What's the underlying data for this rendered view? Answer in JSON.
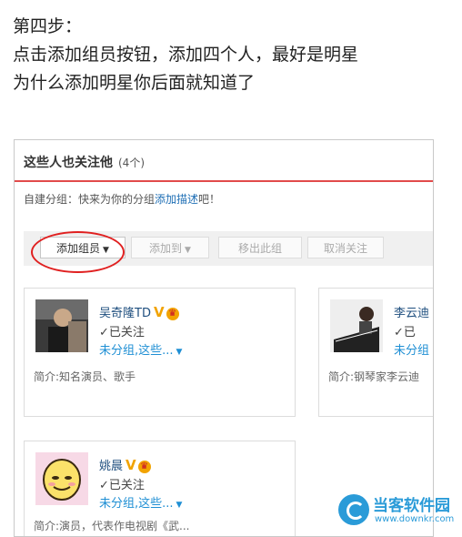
{
  "tutorial": {
    "step": "第四步：",
    "line1": "点击添加组员按钮，添加四个人，最好是明星",
    "line2": "为什么添加明星你后面就知道了"
  },
  "panel": {
    "title": "这些人也关注他",
    "count": "(4个)",
    "hint_prefix": "自建分组：快来为你的分组",
    "hint_link": "添加描述",
    "hint_suffix": "吧！"
  },
  "toolbar": {
    "add_member": "添加组员",
    "move_to": "添加到",
    "remove": "移出此组",
    "unfollow": "取消关注"
  },
  "members": [
    {
      "name": "吴奇隆TD",
      "followed": "✓已关注",
      "group": "未分组,这些...",
      "bio": "简介:知名演员、歌手"
    },
    {
      "name": "李云迪",
      "followed": "✓已",
      "group": "未分组",
      "bio": "简介:钢琴家李云迪"
    },
    {
      "name": "姚晨",
      "followed": "✓已关注",
      "group": "未分组,这些...",
      "bio": "简介:演员，代表作电视剧《武..."
    }
  ],
  "watermark": {
    "title": "当客软件园",
    "url": "www.downkr.com"
  }
}
